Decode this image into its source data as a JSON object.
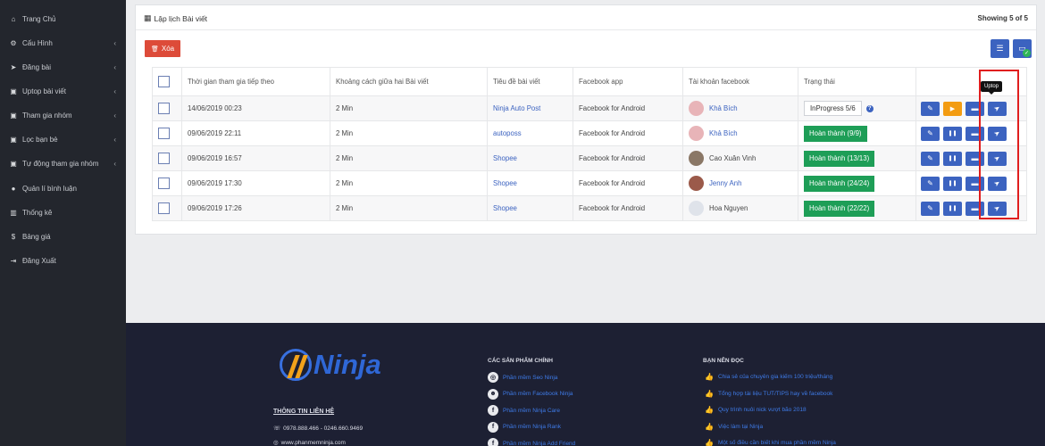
{
  "sidebar": {
    "items": [
      {
        "label": "Trang Chủ",
        "icon": "home-icon",
        "glyph": "⌂",
        "chevron": false
      },
      {
        "label": "Cấu Hình",
        "icon": "gear-icon",
        "glyph": "⚙",
        "chevron": true
      },
      {
        "label": "Đăng bài",
        "icon": "send-icon",
        "glyph": "➤",
        "chevron": true
      },
      {
        "label": "Uptop bài viết",
        "icon": "facebook-square-icon",
        "glyph": "▣",
        "chevron": true
      },
      {
        "label": "Tham gia nhóm",
        "icon": "facebook-square-icon",
        "glyph": "▣",
        "chevron": true
      },
      {
        "label": "Lọc bạn bè",
        "icon": "facebook-square-icon",
        "glyph": "▣",
        "chevron": true
      },
      {
        "label": "Tự động tham gia nhóm",
        "icon": "facebook-square-icon",
        "glyph": "▣",
        "chevron": true
      },
      {
        "label": "Quản lí bình luận",
        "icon": "comment-icon",
        "glyph": "●",
        "chevron": false
      },
      {
        "label": "Thống kê",
        "icon": "chart-icon",
        "glyph": "▥",
        "chevron": false
      },
      {
        "label": "Bảng giá",
        "icon": "dollar-icon",
        "glyph": "$",
        "chevron": false
      },
      {
        "label": "Đăng Xuất",
        "icon": "sign-out-icon",
        "glyph": "⇥",
        "chevron": false
      }
    ],
    "chevron_glyph": "‹"
  },
  "box": {
    "title": "Lập lịch Bài viết",
    "title_icon": "calendar-icon",
    "showing": "Showing 5 of 5",
    "delete_label": "Xóa",
    "delete_icon": "trash-icon"
  },
  "table": {
    "headers": [
      "Thời gian tham gia tiếp theo",
      "Khoảng cách giữa hai Bài viết",
      "Tiêu đề bài viết",
      "Facebook app",
      "Tài khoản facebook",
      "Trạng thái"
    ],
    "rows": [
      {
        "time": "14/06/2019 00:23",
        "interval": "2 Min",
        "title": "Ninja Auto Post",
        "app": "Facebook for Android",
        "account": "Khả Bích",
        "account_link": true,
        "status": "InProgress 5/6",
        "status_type": "progress",
        "state": "paused"
      },
      {
        "time": "09/06/2019 22:11",
        "interval": "2 Min",
        "title": "autoposs",
        "app": "Facebook for Android",
        "account": "Khả Bích",
        "account_link": true,
        "status": "Hoàn thành (9/9)",
        "status_type": "done",
        "state": "running"
      },
      {
        "time": "09/06/2019 16:57",
        "interval": "2 Min",
        "title": "Shopee",
        "app": "Facebook for Android",
        "account": "Cao Xuân Vinh",
        "account_link": false,
        "status": "Hoàn thành (13/13)",
        "status_type": "done",
        "state": "running"
      },
      {
        "time": "09/06/2019 17:30",
        "interval": "2 Min",
        "title": "Shopee",
        "app": "Facebook for Android",
        "account": "Jenny Anh",
        "account_link": true,
        "status": "Hoàn thành (24/24)",
        "status_type": "done",
        "state": "running"
      },
      {
        "time": "09/06/2019 17:26",
        "interval": "2 Min",
        "title": "Shopee",
        "app": "Facebook for Android",
        "account": "Hoa Nguyen",
        "account_link": false,
        "status": "Hoàn thành (22/22)",
        "status_type": "done",
        "state": "running"
      }
    ],
    "avatar_colors": [
      "#e8b4b8",
      "#e8b4b8",
      "#8a7766",
      "#9b5a4a",
      "#dfe3ea"
    ]
  },
  "tooltip": "Uptop",
  "footer": {
    "logo_text": "Ninja",
    "contact_title": "THÔNG TIN LIÊN HỆ",
    "phone": "0978.888.466 - 0246.660.9469",
    "website": "www.phanmemninja.com",
    "products_title": "CÁC SẢN PHẨM CHÍNH",
    "products": [
      {
        "label": "Phần mềm Seo Ninja",
        "icon": "globe-icon",
        "glyph": "◎"
      },
      {
        "label": "Phần mềm Facebook Ninja",
        "icon": "users-icon",
        "glyph": "☻"
      },
      {
        "label": "Phần mềm Ninja Care",
        "icon": "facebook-icon",
        "glyph": "f"
      },
      {
        "label": "Phần mềm Ninja Rank",
        "icon": "facebook-icon",
        "glyph": "f"
      },
      {
        "label": "Phần mềm Ninja Add Friend",
        "icon": "facebook-icon",
        "glyph": "f"
      }
    ],
    "read_title": "BẠN NÊN ĐỌC",
    "reads": [
      "Chia sẻ của chuyên gia kiếm 100 triệu/tháng",
      "Tổng hợp tài liệu TUT/TIPS hay về facebook",
      "Quy trình nuôi nick vượt bão 2018",
      "Việc làm tại Ninja",
      "Một số điều cần biết khi mua phần mềm Ninja"
    ]
  }
}
